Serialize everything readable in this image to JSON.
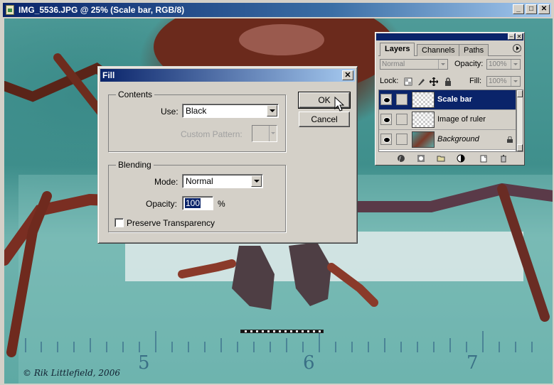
{
  "window": {
    "title": "IMG_5536.JPG @ 25% (Scale bar, RGB/8)",
    "buttons": {
      "minimize": "_",
      "maximize": "□",
      "close": "✕"
    }
  },
  "canvas": {
    "ruler_labels": [
      "5",
      "6",
      "7"
    ],
    "copyright": "© Rik Littlefield, 2006"
  },
  "fill_dialog": {
    "title": "Fill",
    "close": "✕",
    "contents_legend": "Contents",
    "use_label": "Use:",
    "use_value": "Black",
    "custom_pattern_label": "Custom Pattern:",
    "blending_legend": "Blending",
    "mode_label": "Mode:",
    "mode_value": "Normal",
    "opacity_label": "Opacity:",
    "opacity_value": "100",
    "opacity_unit": "%",
    "preserve_label": "Preserve Transparency",
    "ok_label": "OK",
    "cancel_label": "Cancel"
  },
  "layers_palette": {
    "tabs": [
      "Layers",
      "Channels",
      "Paths"
    ],
    "blend_mode": "Normal",
    "opacity_label": "Opacity:",
    "opacity_value": "100%",
    "lock_label": "Lock:",
    "fill_label": "Fill:",
    "fill_value": "100%",
    "layers": [
      {
        "name": "Scale bar",
        "selected": true
      },
      {
        "name": "Image of ruler",
        "selected": false
      },
      {
        "name": "Background",
        "selected": false,
        "locked": true
      }
    ],
    "bottom_icons": [
      "link-layers-icon",
      "layer-style-icon",
      "layer-mask-icon",
      "new-group-icon",
      "adjustment-layer-icon",
      "new-layer-icon",
      "trash-icon"
    ]
  },
  "colors": {
    "title_bar": "#0a246a",
    "selection": "#0a246a",
    "dialog_bg": "#d4d0c8"
  }
}
